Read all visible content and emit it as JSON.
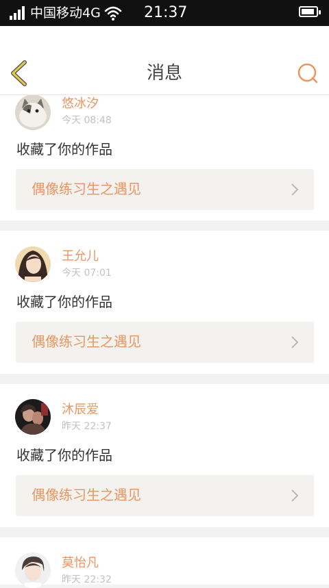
{
  "status_bar": {
    "carrier": "中国移动4G",
    "time": "21:37"
  },
  "nav": {
    "title": "消息"
  },
  "messages": [
    {
      "user": "悠冰汐",
      "time": "今天 08:48",
      "action": "收藏了你的作品",
      "work": "偶像练习生之遇见"
    },
    {
      "user": "王允儿",
      "time": "今天 07:01",
      "action": "收藏了你的作品",
      "work": "偶像练习生之遇见"
    },
    {
      "user": "沐辰爱",
      "time": "昨天 22:37",
      "action": "收藏了你的作品",
      "work": "偶像练习生之遇见"
    },
    {
      "user": "莫怡凡",
      "time": "昨天 22:32"
    }
  ],
  "colors": {
    "accent": "#ec9560",
    "back_icon": "#e8c84a",
    "link_background": "#f3f2ee"
  }
}
